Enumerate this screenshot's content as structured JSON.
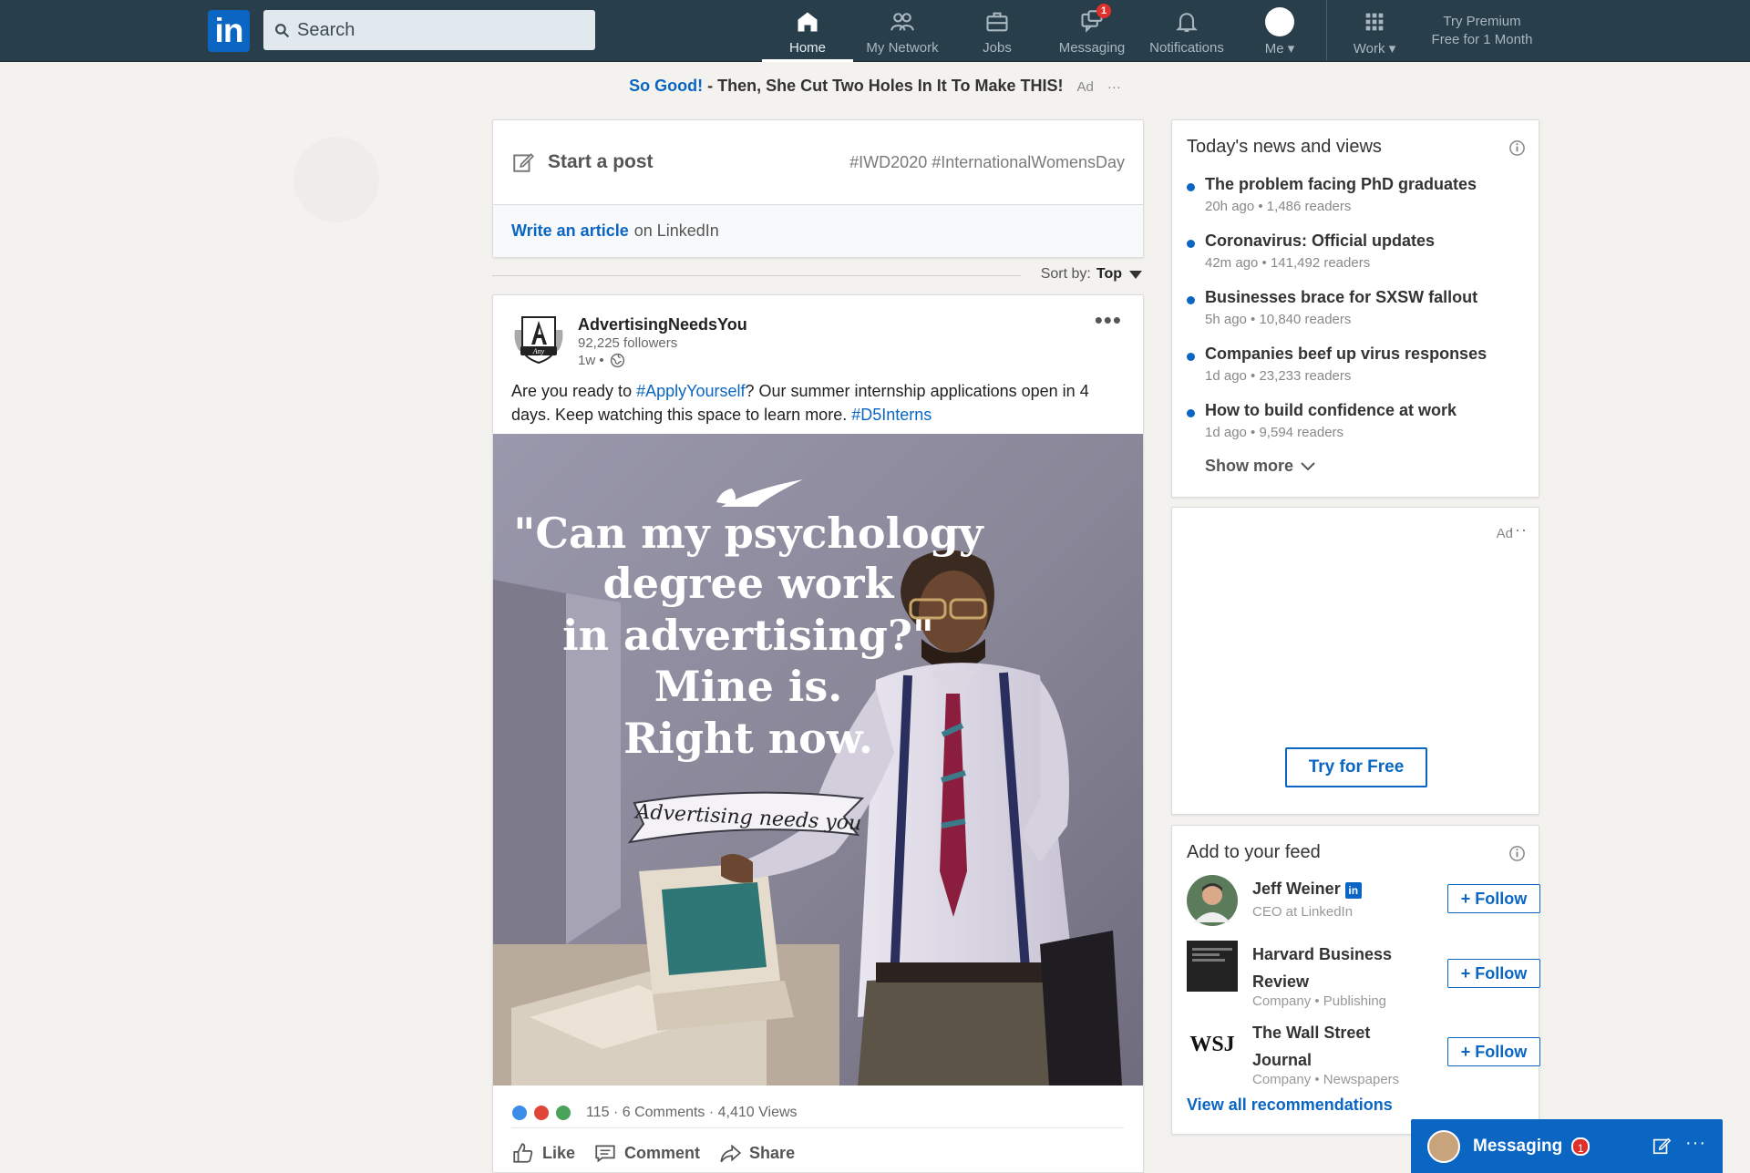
{
  "nav": {
    "logo_text": "in",
    "search_placeholder": "Search",
    "items": [
      {
        "label": "Home",
        "icon": "home-icon"
      },
      {
        "label": "My Network",
        "icon": "network-icon"
      },
      {
        "label": "Jobs",
        "icon": "briefcase-icon"
      },
      {
        "label": "Messaging",
        "icon": "message-icon",
        "badge": "1"
      },
      {
        "label": "Notifications",
        "icon": "bell-icon"
      },
      {
        "label": "Me",
        "icon": "avatar"
      },
      {
        "label": "Work",
        "icon": "grid-icon"
      }
    ],
    "premium_line1": "Try Premium",
    "premium_line2": "Free for 1 Month"
  },
  "top_ad": {
    "highlight": "So Good!",
    "text": " - Then, She Cut Two Holes In It To Make THIS!",
    "label": "Ad",
    "dots": "···"
  },
  "share": {
    "start_post": "Start a post",
    "hashtags": "#IWD2020 #InternationalWomensDay",
    "write_article": "Write an article",
    "on_linkedin": "on LinkedIn"
  },
  "sort": {
    "label": "Sort by:",
    "value": "Top"
  },
  "post": {
    "company": "AdvertisingNeedsYou",
    "followers": "92,225 followers",
    "age": "1w •",
    "text_1": "Are you ready to ",
    "hashtag_1": "#ApplyYourself",
    "text_2": "? Our summer internship applications open in 4 days.  Keep watching this space to learn more. ",
    "hashtag_2": "#D5Interns",
    "image": {
      "quote_line1": "\"Can my psychology",
      "quote_line2": "degree work",
      "quote_line3": "in advertising?\"",
      "quote_line4": "Mine is.",
      "quote_line5": "Right now.",
      "banner": "Advertising needs you"
    },
    "reaction_count": "115",
    "comments": "6 Comments",
    "views": "4,410 Views",
    "like": "Like",
    "comment": "Comment",
    "share": "Share",
    "reaction_colors": [
      "#3b8ce8",
      "#e0453a",
      "#4aa35a"
    ]
  },
  "news": {
    "title": "Today's news and views",
    "items": [
      {
        "headline": "The problem facing PhD graduates",
        "meta": "20h ago • 1,486 readers"
      },
      {
        "headline": "Coronavirus: Official updates",
        "meta": "42m ago • 141,492 readers"
      },
      {
        "headline": "Businesses brace for SXSW fallout",
        "meta": "5h ago • 10,840 readers"
      },
      {
        "headline": "Companies beef up virus responses",
        "meta": "1d ago • 23,233 readers"
      },
      {
        "headline": "How to build confidence at work",
        "meta": "1d ago • 9,594 readers"
      }
    ],
    "show_more": "Show more"
  },
  "ad_box": {
    "label": "Ad",
    "dots": "···",
    "button": "Try for Free"
  },
  "feed": {
    "title": "Add to your feed",
    "recs": [
      {
        "name": "Jeff Weiner",
        "sub": "CEO at LinkedIn",
        "follow": "+ Follow"
      },
      {
        "name": "Harvard Business Review",
        "sub": "Company • Publishing",
        "follow": "+ Follow"
      },
      {
        "name": "The Wall Street Journal",
        "sub": "Company • Newspapers",
        "follow": "+ Follow",
        "logo_text": "WSJ"
      }
    ],
    "view_all": "View all recommendations"
  },
  "messaging": {
    "label": "Messaging",
    "badge": "1",
    "dots": "···"
  },
  "colors": {
    "nav_bg": "#283e4a",
    "brand_blue": "#0a66c2",
    "page_bg": "#f3f2ef"
  }
}
